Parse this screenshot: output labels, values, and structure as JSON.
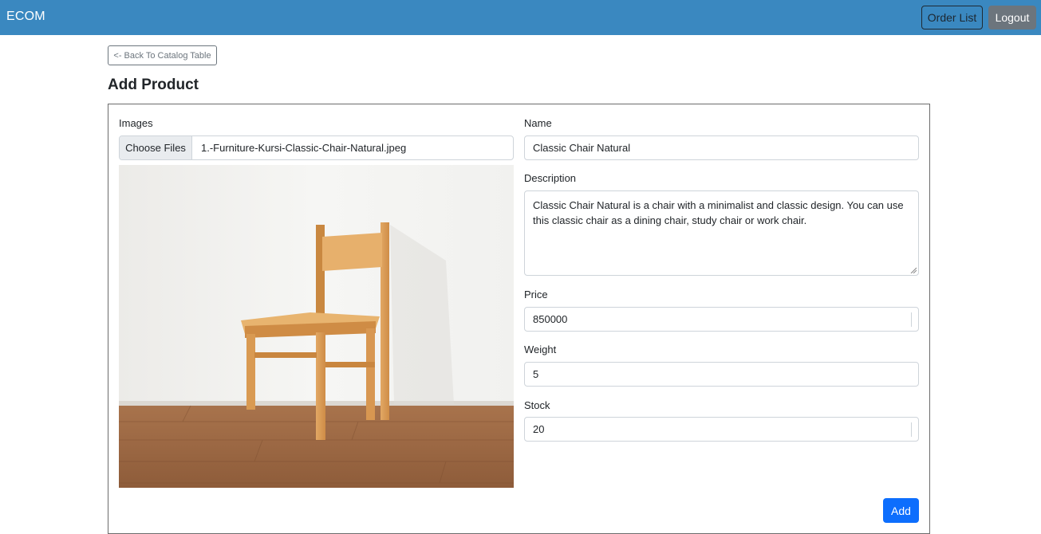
{
  "navbar": {
    "brand": "ECOM",
    "order_list_label": "Order List",
    "logout_label": "Logout",
    "color": "#3a88c0"
  },
  "back_button_label": "<- Back To Catalog Table",
  "page_title": "Add Product",
  "form": {
    "images": {
      "label": "Images",
      "choose_files_label": "Choose Files",
      "file_name": "1.-Furniture-Kursi-Classic-Chair-Natural.jpeg"
    },
    "name": {
      "label": "Name",
      "value": "Classic Chair Natural"
    },
    "description": {
      "label": "Description",
      "value": "Classic Chair Natural is a chair with a minimalist and classic design. You can use this classic chair as a dining chair, study chair or work chair."
    },
    "price": {
      "label": "Price",
      "value": "850000"
    },
    "weight": {
      "label": "Weight",
      "value": "5"
    },
    "stock": {
      "label": "Stock",
      "value": "20"
    },
    "add_label": "Add",
    "add_color": "#0d6efd"
  }
}
